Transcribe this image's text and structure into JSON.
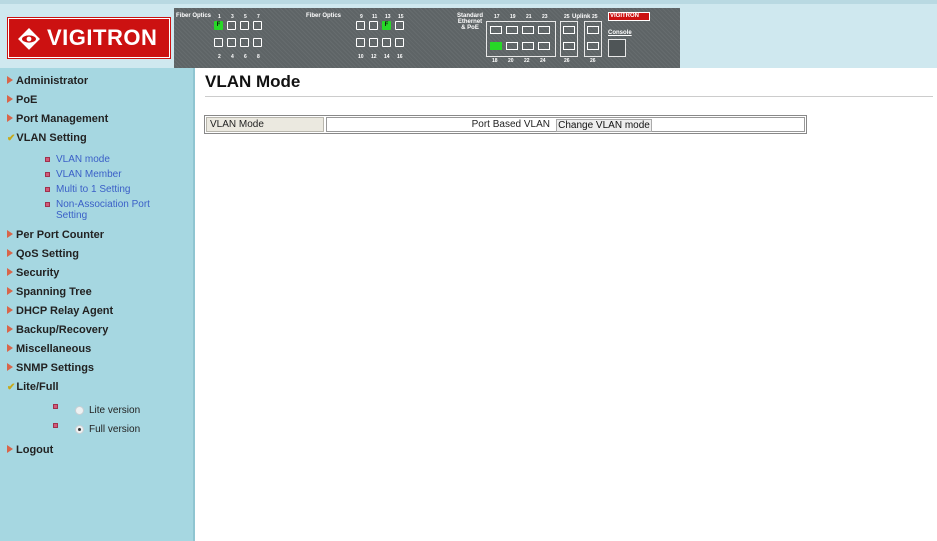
{
  "header": {
    "logo_text": "VIGITRON",
    "panel": {
      "labels": {
        "fiber1": "Fiber Optics",
        "fiber2": "Fiber Optics",
        "standard": "Standard\nEthernet\n& PoE",
        "uplink": "Uplink",
        "console": "Console",
        "brand": "VIGITRON"
      },
      "top_numbers_g1": [
        "1",
        "3",
        "5",
        "7"
      ],
      "bottom_numbers_g1": [
        "2",
        "4",
        "6",
        "8"
      ],
      "top_numbers_g2": [
        "9",
        "11",
        "13",
        "15"
      ],
      "bottom_numbers_g2": [
        "10",
        "12",
        "14",
        "16"
      ],
      "top_numbers_g3": [
        "17",
        "19",
        "21",
        "23"
      ],
      "bottom_numbers_g3": [
        "18",
        "20",
        "22",
        "24"
      ],
      "top_numbers_g4": [
        "25",
        "25"
      ],
      "bottom_numbers_g4": [
        "26",
        "26"
      ],
      "fiber_marker": "F"
    }
  },
  "sidebar": {
    "items": [
      {
        "label": "Administrator"
      },
      {
        "label": "PoE"
      },
      {
        "label": "Port Management"
      },
      {
        "label": "VLAN Setting"
      },
      {
        "label": "Per Port Counter"
      },
      {
        "label": "QoS Setting"
      },
      {
        "label": "Security"
      },
      {
        "label": "Spanning Tree"
      },
      {
        "label": "DHCP Relay Agent"
      },
      {
        "label": "Backup/Recovery"
      },
      {
        "label": "Miscellaneous"
      },
      {
        "label": "SNMP Settings"
      },
      {
        "label": "Lite/Full"
      },
      {
        "label": "Logout"
      }
    ],
    "vlan_subitems": [
      {
        "label": "VLAN mode"
      },
      {
        "label": "VLAN Member"
      },
      {
        "label": "Multi to 1 Setting"
      },
      {
        "label": "Non-Association Port Setting"
      }
    ],
    "lite_full_options": [
      {
        "label": "Lite version",
        "selected": false
      },
      {
        "label": "Full version",
        "selected": true
      }
    ]
  },
  "main": {
    "title": "VLAN Mode",
    "vlan_mode_label": "VLAN Mode",
    "vlan_mode_value": "Port Based VLAN",
    "change_button": "Change VLAN mode"
  },
  "colors": {
    "sidebar_bg": "#a6d7e1",
    "header_bg": "#cfe8ef",
    "logo_red": "#cc1111",
    "link": "#3a5fc7",
    "active_port": "#27d827"
  }
}
